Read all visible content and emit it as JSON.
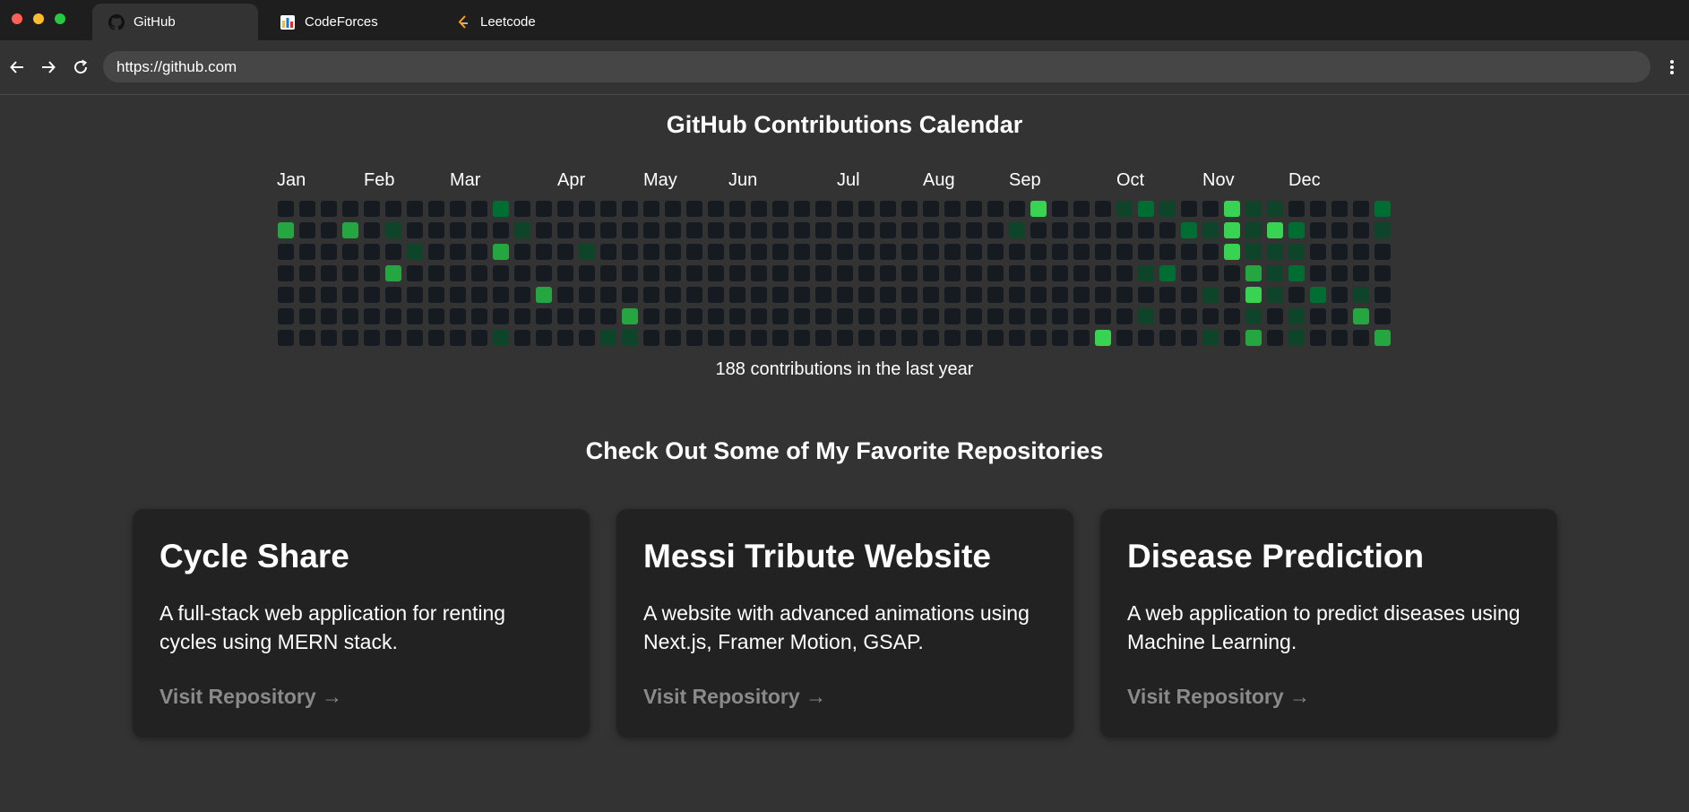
{
  "browser": {
    "tabs": [
      {
        "label": "GitHub",
        "icon": "github-icon",
        "active": true
      },
      {
        "label": "CodeForces",
        "icon": "codeforces-icon",
        "active": false
      },
      {
        "label": "Leetcode",
        "icon": "leetcode-icon",
        "active": false
      }
    ],
    "url": "https://github.com"
  },
  "calendar": {
    "title": "GitHub Contributions Calendar",
    "months": [
      "Jan",
      "Feb",
      "Mar",
      "Apr",
      "May",
      "Jun",
      "Jul",
      "Aug",
      "Sep",
      "Oct",
      "Nov",
      "Dec"
    ],
    "total_label": "188 contributions in the last year",
    "level_colors": [
      "#161b22",
      "#0e4429",
      "#006d32",
      "#26a641",
      "#39d353"
    ],
    "weeks": 52,
    "days_per_week": 7,
    "contributions": [
      {
        "week": 10,
        "day": 0,
        "level": 2
      },
      {
        "week": 35,
        "day": 0,
        "level": 4
      },
      {
        "week": 39,
        "day": 0,
        "level": 1
      },
      {
        "week": 40,
        "day": 0,
        "level": 2
      },
      {
        "week": 41,
        "day": 0,
        "level": 1
      },
      {
        "week": 44,
        "day": 0,
        "level": 4
      },
      {
        "week": 45,
        "day": 0,
        "level": 1
      },
      {
        "week": 46,
        "day": 0,
        "level": 1
      },
      {
        "week": 51,
        "day": 0,
        "level": 2
      },
      {
        "week": 0,
        "day": 1,
        "level": 3
      },
      {
        "week": 3,
        "day": 1,
        "level": 3
      },
      {
        "week": 5,
        "day": 1,
        "level": 1
      },
      {
        "week": 11,
        "day": 1,
        "level": 1
      },
      {
        "week": 34,
        "day": 1,
        "level": 1
      },
      {
        "week": 42,
        "day": 1,
        "level": 2
      },
      {
        "week": 43,
        "day": 1,
        "level": 1
      },
      {
        "week": 44,
        "day": 1,
        "level": 4
      },
      {
        "week": 45,
        "day": 1,
        "level": 1
      },
      {
        "week": 46,
        "day": 1,
        "level": 4
      },
      {
        "week": 47,
        "day": 1,
        "level": 2
      },
      {
        "week": 51,
        "day": 1,
        "level": 1
      },
      {
        "week": 6,
        "day": 2,
        "level": 1
      },
      {
        "week": 10,
        "day": 2,
        "level": 3
      },
      {
        "week": 14,
        "day": 2,
        "level": 1
      },
      {
        "week": 44,
        "day": 2,
        "level": 4
      },
      {
        "week": 45,
        "day": 2,
        "level": 1
      },
      {
        "week": 46,
        "day": 2,
        "level": 1
      },
      {
        "week": 47,
        "day": 2,
        "level": 1
      },
      {
        "week": 5,
        "day": 3,
        "level": 3
      },
      {
        "week": 40,
        "day": 3,
        "level": 1
      },
      {
        "week": 41,
        "day": 3,
        "level": 2
      },
      {
        "week": 45,
        "day": 3,
        "level": 3
      },
      {
        "week": 46,
        "day": 3,
        "level": 1
      },
      {
        "week": 47,
        "day": 3,
        "level": 2
      },
      {
        "week": 12,
        "day": 4,
        "level": 3
      },
      {
        "week": 43,
        "day": 4,
        "level": 1
      },
      {
        "week": 45,
        "day": 4,
        "level": 4
      },
      {
        "week": 46,
        "day": 4,
        "level": 1
      },
      {
        "week": 48,
        "day": 4,
        "level": 2
      },
      {
        "week": 50,
        "day": 4,
        "level": 1
      },
      {
        "week": 16,
        "day": 5,
        "level": 3
      },
      {
        "week": 40,
        "day": 5,
        "level": 1
      },
      {
        "week": 45,
        "day": 5,
        "level": 1
      },
      {
        "week": 47,
        "day": 5,
        "level": 1
      },
      {
        "week": 50,
        "day": 5,
        "level": 3
      },
      {
        "week": 10,
        "day": 6,
        "level": 1
      },
      {
        "week": 15,
        "day": 6,
        "level": 1
      },
      {
        "week": 16,
        "day": 6,
        "level": 1
      },
      {
        "week": 38,
        "day": 6,
        "level": 4
      },
      {
        "week": 43,
        "day": 6,
        "level": 1
      },
      {
        "week": 45,
        "day": 6,
        "level": 3
      },
      {
        "week": 47,
        "day": 6,
        "level": 1
      },
      {
        "week": 51,
        "day": 6,
        "level": 3
      }
    ]
  },
  "repos": {
    "title": "Check Out Some of My Favorite Repositories",
    "items": [
      {
        "name": "Cycle Share",
        "description": "A full-stack web application for renting cycles using MERN stack.",
        "link_label": "Visit Repository →"
      },
      {
        "name": "Messi Tribute Website",
        "description": "A website with advanced animations using Next.js, Framer Motion, GSAP.",
        "link_label": "Visit Repository →"
      },
      {
        "name": "Disease Prediction",
        "description": "A web application to predict diseases using Machine Learning.",
        "link_label": "Visit Repository →"
      }
    ]
  }
}
